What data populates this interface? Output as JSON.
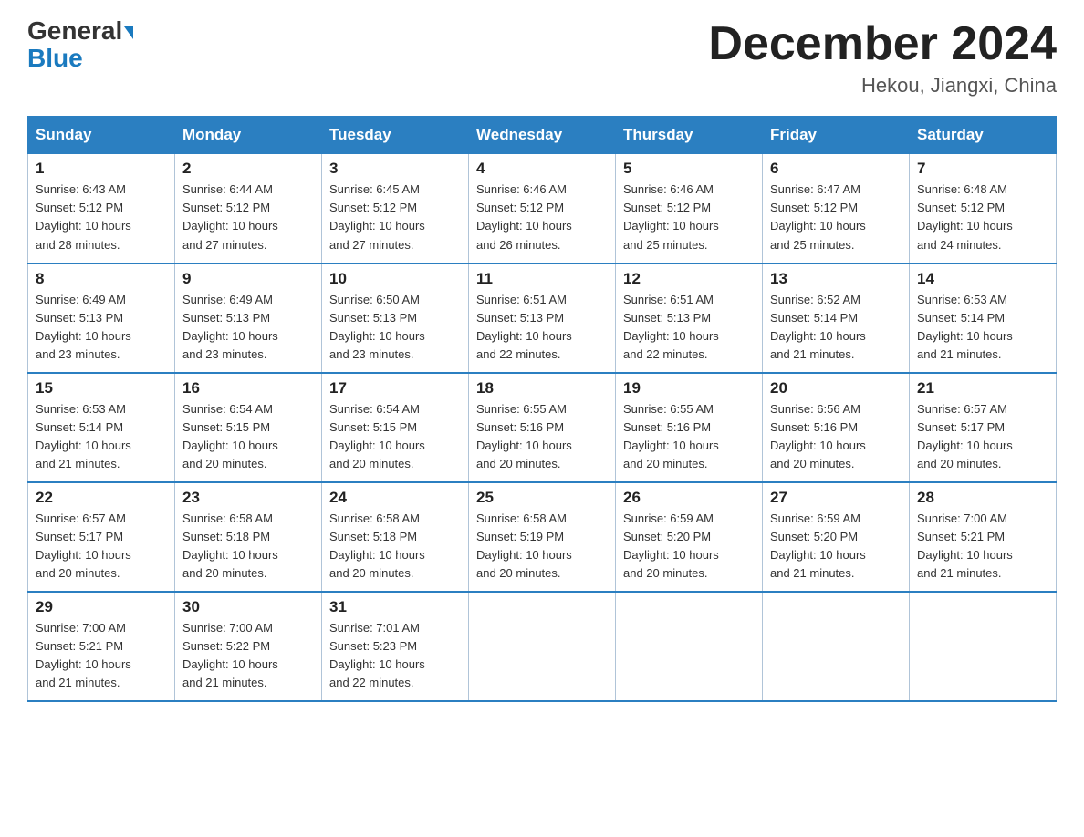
{
  "header": {
    "logo_general": "General",
    "logo_blue": "Blue",
    "month_title": "December 2024",
    "location": "Hekou, Jiangxi, China"
  },
  "weekdays": [
    "Sunday",
    "Monday",
    "Tuesday",
    "Wednesday",
    "Thursday",
    "Friday",
    "Saturday"
  ],
  "weeks": [
    [
      {
        "day": "1",
        "sunrise": "6:43 AM",
        "sunset": "5:12 PM",
        "daylight": "10 hours and 28 minutes."
      },
      {
        "day": "2",
        "sunrise": "6:44 AM",
        "sunset": "5:12 PM",
        "daylight": "10 hours and 27 minutes."
      },
      {
        "day": "3",
        "sunrise": "6:45 AM",
        "sunset": "5:12 PM",
        "daylight": "10 hours and 27 minutes."
      },
      {
        "day": "4",
        "sunrise": "6:46 AM",
        "sunset": "5:12 PM",
        "daylight": "10 hours and 26 minutes."
      },
      {
        "day": "5",
        "sunrise": "6:46 AM",
        "sunset": "5:12 PM",
        "daylight": "10 hours and 25 minutes."
      },
      {
        "day": "6",
        "sunrise": "6:47 AM",
        "sunset": "5:12 PM",
        "daylight": "10 hours and 25 minutes."
      },
      {
        "day": "7",
        "sunrise": "6:48 AM",
        "sunset": "5:12 PM",
        "daylight": "10 hours and 24 minutes."
      }
    ],
    [
      {
        "day": "8",
        "sunrise": "6:49 AM",
        "sunset": "5:13 PM",
        "daylight": "10 hours and 23 minutes."
      },
      {
        "day": "9",
        "sunrise": "6:49 AM",
        "sunset": "5:13 PM",
        "daylight": "10 hours and 23 minutes."
      },
      {
        "day": "10",
        "sunrise": "6:50 AM",
        "sunset": "5:13 PM",
        "daylight": "10 hours and 23 minutes."
      },
      {
        "day": "11",
        "sunrise": "6:51 AM",
        "sunset": "5:13 PM",
        "daylight": "10 hours and 22 minutes."
      },
      {
        "day": "12",
        "sunrise": "6:51 AM",
        "sunset": "5:13 PM",
        "daylight": "10 hours and 22 minutes."
      },
      {
        "day": "13",
        "sunrise": "6:52 AM",
        "sunset": "5:14 PM",
        "daylight": "10 hours and 21 minutes."
      },
      {
        "day": "14",
        "sunrise": "6:53 AM",
        "sunset": "5:14 PM",
        "daylight": "10 hours and 21 minutes."
      }
    ],
    [
      {
        "day": "15",
        "sunrise": "6:53 AM",
        "sunset": "5:14 PM",
        "daylight": "10 hours and 21 minutes."
      },
      {
        "day": "16",
        "sunrise": "6:54 AM",
        "sunset": "5:15 PM",
        "daylight": "10 hours and 20 minutes."
      },
      {
        "day": "17",
        "sunrise": "6:54 AM",
        "sunset": "5:15 PM",
        "daylight": "10 hours and 20 minutes."
      },
      {
        "day": "18",
        "sunrise": "6:55 AM",
        "sunset": "5:16 PM",
        "daylight": "10 hours and 20 minutes."
      },
      {
        "day": "19",
        "sunrise": "6:55 AM",
        "sunset": "5:16 PM",
        "daylight": "10 hours and 20 minutes."
      },
      {
        "day": "20",
        "sunrise": "6:56 AM",
        "sunset": "5:16 PM",
        "daylight": "10 hours and 20 minutes."
      },
      {
        "day": "21",
        "sunrise": "6:57 AM",
        "sunset": "5:17 PM",
        "daylight": "10 hours and 20 minutes."
      }
    ],
    [
      {
        "day": "22",
        "sunrise": "6:57 AM",
        "sunset": "5:17 PM",
        "daylight": "10 hours and 20 minutes."
      },
      {
        "day": "23",
        "sunrise": "6:58 AM",
        "sunset": "5:18 PM",
        "daylight": "10 hours and 20 minutes."
      },
      {
        "day": "24",
        "sunrise": "6:58 AM",
        "sunset": "5:18 PM",
        "daylight": "10 hours and 20 minutes."
      },
      {
        "day": "25",
        "sunrise": "6:58 AM",
        "sunset": "5:19 PM",
        "daylight": "10 hours and 20 minutes."
      },
      {
        "day": "26",
        "sunrise": "6:59 AM",
        "sunset": "5:20 PM",
        "daylight": "10 hours and 20 minutes."
      },
      {
        "day": "27",
        "sunrise": "6:59 AM",
        "sunset": "5:20 PM",
        "daylight": "10 hours and 21 minutes."
      },
      {
        "day": "28",
        "sunrise": "7:00 AM",
        "sunset": "5:21 PM",
        "daylight": "10 hours and 21 minutes."
      }
    ],
    [
      {
        "day": "29",
        "sunrise": "7:00 AM",
        "sunset": "5:21 PM",
        "daylight": "10 hours and 21 minutes."
      },
      {
        "day": "30",
        "sunrise": "7:00 AM",
        "sunset": "5:22 PM",
        "daylight": "10 hours and 21 minutes."
      },
      {
        "day": "31",
        "sunrise": "7:01 AM",
        "sunset": "5:23 PM",
        "daylight": "10 hours and 22 minutes."
      },
      null,
      null,
      null,
      null
    ]
  ],
  "labels": {
    "sunrise": "Sunrise:",
    "sunset": "Sunset:",
    "daylight": "Daylight:"
  }
}
